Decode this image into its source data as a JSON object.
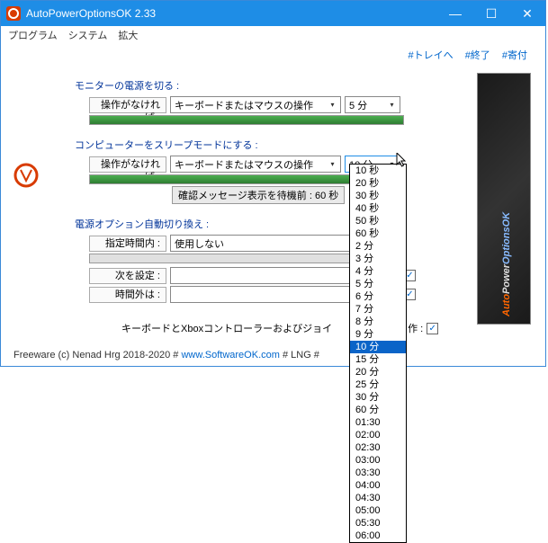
{
  "window": {
    "title": "AutoPowerOptionsOK 2.33"
  },
  "menubar": {
    "program": "プログラム",
    "system": "システム",
    "expand": "拡大"
  },
  "linkbar": {
    "tray": "#トレイへ",
    "exit": "#終了",
    "donate": "#寄付"
  },
  "section1": {
    "title": "モニターの電源を切る :",
    "if_no_op": "操作がなければ :",
    "combo1": "キーボードまたはマウスの操作",
    "combo2": "5 分"
  },
  "section2": {
    "title": "コンピューターをスリープモードにする :",
    "if_no_op": "操作がなければ :",
    "combo1": "キーボードまたはマウスの操作",
    "combo2": "10 分",
    "confirm_msg": "確認メッセージ表示を待機前 : 60 秒"
  },
  "section3": {
    "title": "電源オプション自動切り換え :",
    "time_within": "指定時間内 :",
    "not_used": "使用しない",
    "set_next": "次を設定 :",
    "time_outside": "時間外は :",
    "joy_label": "キーボードとXboxコントローラーおよびジョイ",
    "joy_suffix": "作 :"
  },
  "dropdown": {
    "items": [
      "10 秒",
      "20 秒",
      "30 秒",
      "40 秒",
      "50 秒",
      "60 秒",
      "2 分",
      "3 分",
      "4 分",
      "5 分",
      "6 分",
      "7 分",
      "8 分",
      "9 分",
      "10 分",
      "15 分",
      "20 分",
      "25 分",
      "30 分",
      "60 分",
      "01:30",
      "02:00",
      "02:30",
      "03:00",
      "03:30",
      "04:00",
      "04:30",
      "05:00",
      "05:30",
      "06:00"
    ],
    "selected_index": 14
  },
  "footer": {
    "text1": "Freeware (c) Nenad Hrg 2018-2020 # ",
    "link": "www.SoftwareOK.com",
    "text2": "   # LNG   #"
  },
  "banner": {
    "p1": "Auto",
    "p2": "Power",
    "p3": "OptionsOK"
  },
  "checkmark": "✓"
}
